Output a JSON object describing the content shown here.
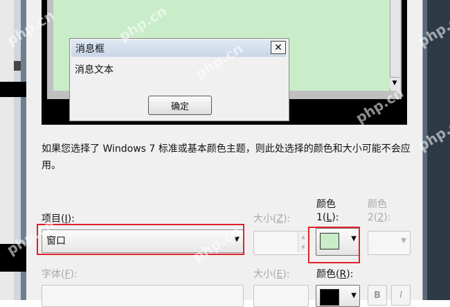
{
  "preview": {
    "message_box": {
      "title": "消息框",
      "close_glyph": "✕",
      "text": "消息文本",
      "ok_label": "确定"
    },
    "client_color": "#c9ecc9"
  },
  "description": "如果您选择了 Windows 7 标准或基本颜色主题，则此处选择的颜色和大小可能不会应用。",
  "item": {
    "label_prefix": "项目(",
    "label_key": "I",
    "label_suffix": "):",
    "value": "窗口"
  },
  "size1": {
    "label_prefix": "大小(",
    "label_key": "Z",
    "label_suffix": "):"
  },
  "color1": {
    "label_line1": "颜色",
    "label_prefix": "1(",
    "label_key": "L",
    "label_suffix": "):",
    "swatch_color": "#c9ecc9"
  },
  "color2": {
    "label_line1": "颜色",
    "label_prefix": "2(",
    "label_key": "2",
    "label_suffix": "):"
  },
  "font": {
    "label_prefix": "字体(",
    "label_key": "F",
    "label_suffix": "):"
  },
  "size2": {
    "label_prefix": "大小(",
    "label_key": "E",
    "label_suffix": "):"
  },
  "font_color": {
    "label_prefix": "颜色(",
    "label_key": "R",
    "label_suffix": "):",
    "swatch_color": "#000000"
  },
  "bold_label": "B",
  "italic_label": "I",
  "watermark": "php.cn",
  "accent_highlight": "#e0202a"
}
